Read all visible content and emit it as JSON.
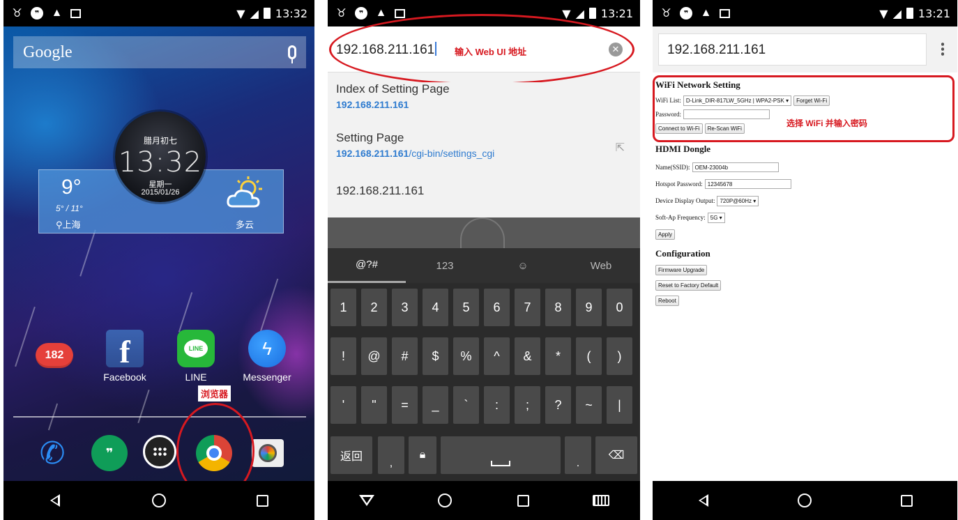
{
  "status": {
    "screen1_time": "13:32",
    "screen2_time": "13:21",
    "screen3_time": "13:21"
  },
  "home": {
    "search_logo": "Google",
    "clock_lunar": "腊月初七",
    "clock_time": "13:32",
    "clock_weekday": "星期一",
    "clock_date": "2015/01/26",
    "weather_temp": "9°",
    "weather_range": "5° / 11°",
    "weather_city": "上海",
    "weather_condition": "多云",
    "apps": [
      {
        "label": "",
        "badge": "182"
      },
      {
        "label": "Facebook"
      },
      {
        "label": "LINE",
        "icon_text": "LINE"
      },
      {
        "label": "Messenger"
      }
    ],
    "browser_annotation": "浏览器"
  },
  "browser": {
    "url_value": "192.168.211.161",
    "url_annotation": "输入 Web UI 地址",
    "suggestions": [
      {
        "title": "Index of Setting Page",
        "url_host": "192.168.211.161",
        "url_path": ""
      },
      {
        "title": "Setting Page",
        "url_host": "192.168.211.161",
        "url_path": "/cgi-bin/settings_cgi"
      },
      {
        "title": "192.168.211.161",
        "url_host": "",
        "url_path": ""
      }
    ],
    "keyboard_tabs": [
      "@?#",
      "123",
      "☺",
      "Web"
    ],
    "keyboard_row1": [
      "1",
      "2",
      "3",
      "4",
      "5",
      "6",
      "7",
      "8",
      "9",
      "0"
    ],
    "keyboard_row2": [
      "!",
      "@",
      "#",
      "$",
      "%",
      "^",
      "&",
      "*",
      "(",
      ")"
    ],
    "keyboard_row3": [
      "'",
      "\"",
      "=",
      "_",
      "`",
      ":",
      ";",
      "?",
      "~",
      "|"
    ],
    "keyboard_back": "返回",
    "keyboard_comma": ",",
    "keyboard_period": "."
  },
  "settings": {
    "url_value": "192.168.211.161",
    "wifi_heading": "WiFi Network Setting",
    "wifi_list_label": "WiFi List:",
    "wifi_list_value": "D-Link_DIR-817LW_5GHz | WPA2-PSK",
    "forget_wifi": "Forget Wi-Fi",
    "password_label": "Password:",
    "connect_wifi": "Connect to Wi-Fi",
    "rescan_wifi": "Re-Scan WiFi",
    "wifi_annotation": "选择 WiFi 并输入密码",
    "hdmi_heading": "HDMI Dongle",
    "ssid_label": "Name(SSID):",
    "ssid_value": "OEM-23004b",
    "hotspot_label": "Hotspot Password:",
    "hotspot_value": "12345678",
    "display_label": "Device Display Output:",
    "display_value": "720P@60Hz",
    "softap_label": "Soft-Ap Frequency:",
    "softap_value": "5G",
    "apply": "Apply",
    "config_heading": "Configuration",
    "firmware_upgrade": "Firmware Upgrade",
    "factory_reset": "Reset to Factory Default",
    "reboot": "Reboot"
  }
}
